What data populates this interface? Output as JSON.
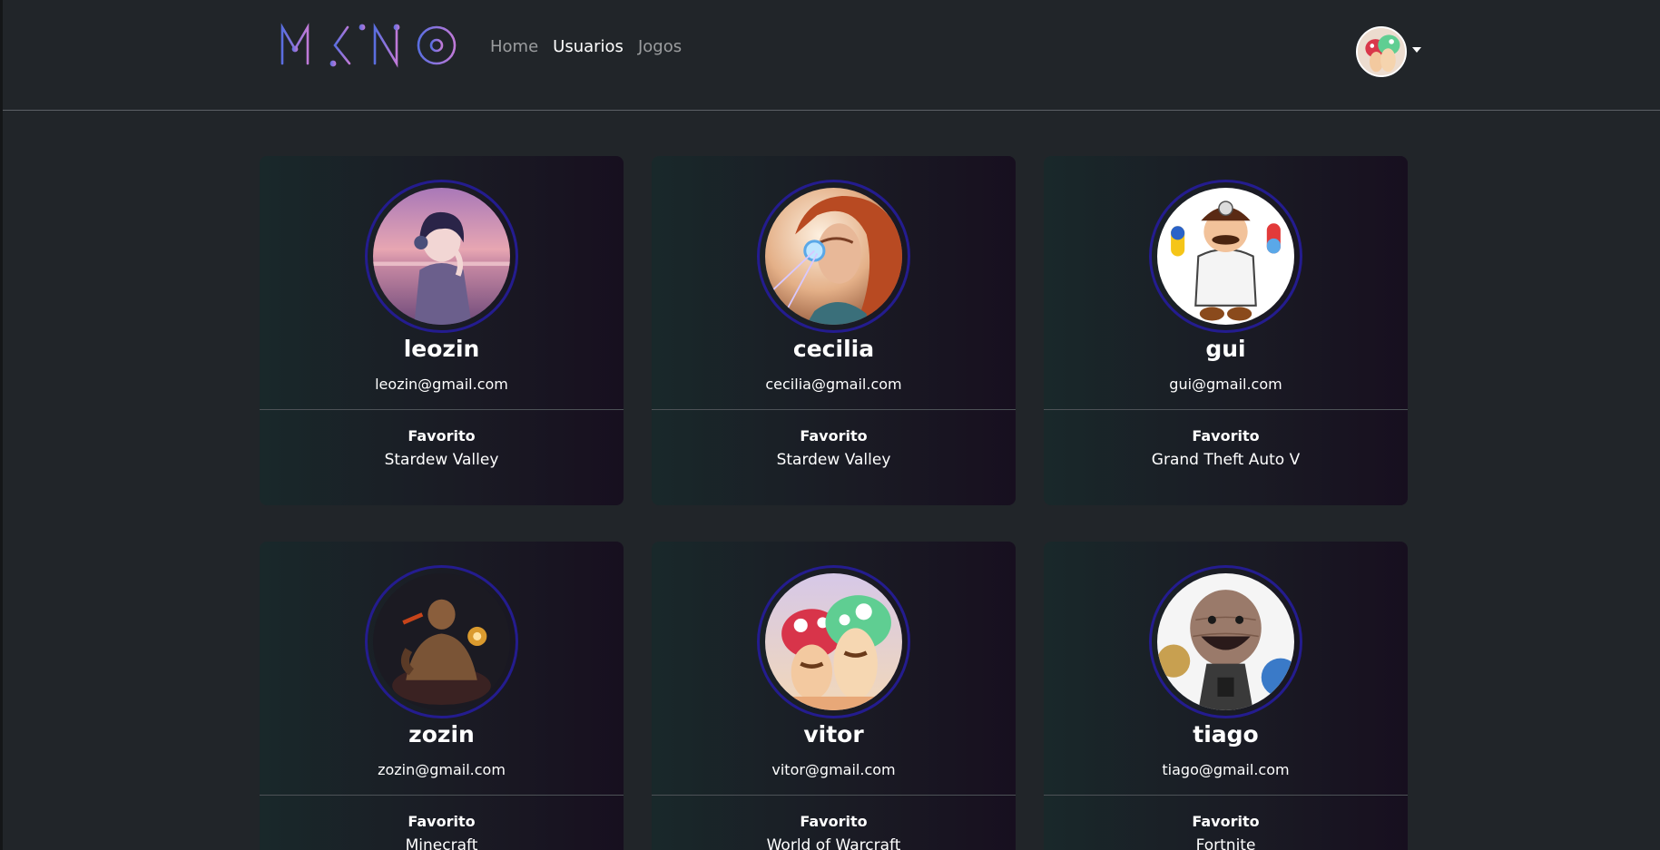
{
  "brand": {
    "logo_text": "IMIKINO"
  },
  "nav": {
    "links": [
      {
        "label": "Home",
        "active": false
      },
      {
        "label": "Usuarios",
        "active": true
      },
      {
        "label": "Jogos",
        "active": false
      }
    ]
  },
  "users": [
    {
      "name": "leozin",
      "email": "leozin@gmail.com",
      "favorite_label": "Favorito",
      "favorite": "Stardew Valley",
      "avatar": "anime-boy-headphones-icon"
    },
    {
      "name": "cecilia",
      "email": "cecilia@gmail.com",
      "favorite_label": "Favorito",
      "favorite": "Stardew Valley",
      "avatar": "aloy-horizon-icon"
    },
    {
      "name": "gui",
      "email": "gui@gmail.com",
      "favorite_label": "Favorito",
      "favorite": "Grand Theft Auto V",
      "avatar": "dr-mario-icon"
    },
    {
      "name": "zozin",
      "email": "zozin@gmail.com",
      "favorite_label": "Favorito",
      "favorite": "Minecraft",
      "avatar": "lee-sin-icon"
    },
    {
      "name": "vitor",
      "email": "vitor@gmail.com",
      "favorite_label": "Favorito",
      "favorite": "World of Warcraft",
      "avatar": "mushroom-duo-icon"
    },
    {
      "name": "tiago",
      "email": "tiago@gmail.com",
      "favorite_label": "Favorito",
      "favorite": "Fortnite",
      "avatar": "sackboy-icon"
    }
  ],
  "colors": {
    "background": "#212529",
    "avatar_ring": "#241c8f",
    "logo_start": "#5a6ee0",
    "logo_end": "#c07ad8"
  }
}
